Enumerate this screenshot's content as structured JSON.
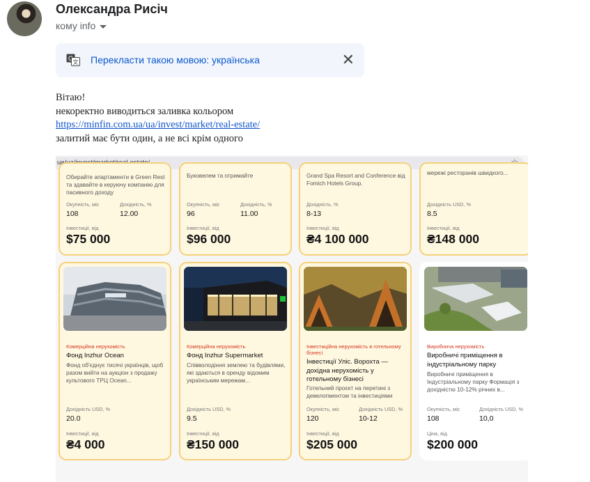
{
  "email": {
    "sender": "Олександра Рисіч",
    "recipient": "кому info",
    "translate_link": "Перекласти такою мовою: українська",
    "close_symbol": "✕",
    "greeting": "Вітаю!",
    "line1": "некоректно виводиться заливка кольором",
    "link": "https://minfin.com.ua/ua/invest/market/real-estate/",
    "line2": "залитий має бути один, а не всі крім одного"
  },
  "browser": {
    "url": "ua/ua/invest/market/real-estate/",
    "star": "☆"
  },
  "cards_top": [
    {
      "desc": "Обирайте апартаменти в Green Rest та здавайте в керуючу компанію для пасивного доходу",
      "label1": "Окупність, міс",
      "value1": "108",
      "label2": "Дохідність, %",
      "value2": "12.00",
      "price_label": "Інвестиції, від",
      "price": "$75 000"
    },
    {
      "desc": "Буковелем та отримайте",
      "label1": "Окупність, міс",
      "value1": "96",
      "label2": "Дохідність, %",
      "value2": "11.00",
      "price_label": "Інвестиції, від",
      "price": "$96 000"
    },
    {
      "desc": "Grand Spa Resort and Conference від Fomich Hotels Group.",
      "label1": "Дохідність, %",
      "value1": "8-13",
      "label2": "",
      "value2": "",
      "price_label": "Інвестиції, від",
      "price": "₴4 100 000"
    },
    {
      "desc": "мережі ресторанів швидкого...",
      "label1": "Дохідність USD, %",
      "value1": "8.5",
      "label2": "",
      "value2": "",
      "price_label": "Інвестиції, від",
      "price": "₴148 000"
    }
  ],
  "cards_bottom": [
    {
      "category": "Комерційна нерухомість",
      "title": "Фонд Inzhur Ocean",
      "desc": "Фонд об'єднує тисячі українців, щоб разом вийти на аукціон з продажу культового ТРЦ Ocean...",
      "label1": "Дохідність USD, %",
      "value1": "20.0",
      "label2": "",
      "value2": "",
      "price_label": "Інвестиції, від",
      "price": "₴4 000"
    },
    {
      "category": "Комерційна нерухомість",
      "title": "Фонд Inzhur Supermarket",
      "desc": "Співволодіння землею та будівлями, які здаються в оренду відомим українським мережам...",
      "label1": "Дохідність USD, %",
      "value1": "9.5",
      "label2": "",
      "value2": "",
      "price_label": "Інвестиції, від",
      "price": "₴150 000"
    },
    {
      "category": "Інвестиційна нерухомість в готельному бізнесі",
      "title": "Інвестиції Уліс. Ворохта — дохідна нерухомість у готельному бізнесі",
      "desc": "Готельний проєкт на перетині з девелопментом та інвестиціями",
      "label1": "Окупність, міс",
      "value1": "120",
      "label2": "Дохідність USD, %",
      "value2": "10-12",
      "price_label": "Інвестиції, від",
      "price": "$205 000"
    },
    {
      "category": "Виробнича нерухомість",
      "title": "Виробничі приміщення в індустріальному парку",
      "desc": "Виробничі приміщення в Індустріальному парку Формація з дохідністю 10-12% річних в...",
      "label1": "Окупність, міс",
      "value1": "108",
      "label2": "Дохідність USD, %",
      "value2": "10,0",
      "price_label": "Ціна, від",
      "price": "$200 000"
    }
  ]
}
